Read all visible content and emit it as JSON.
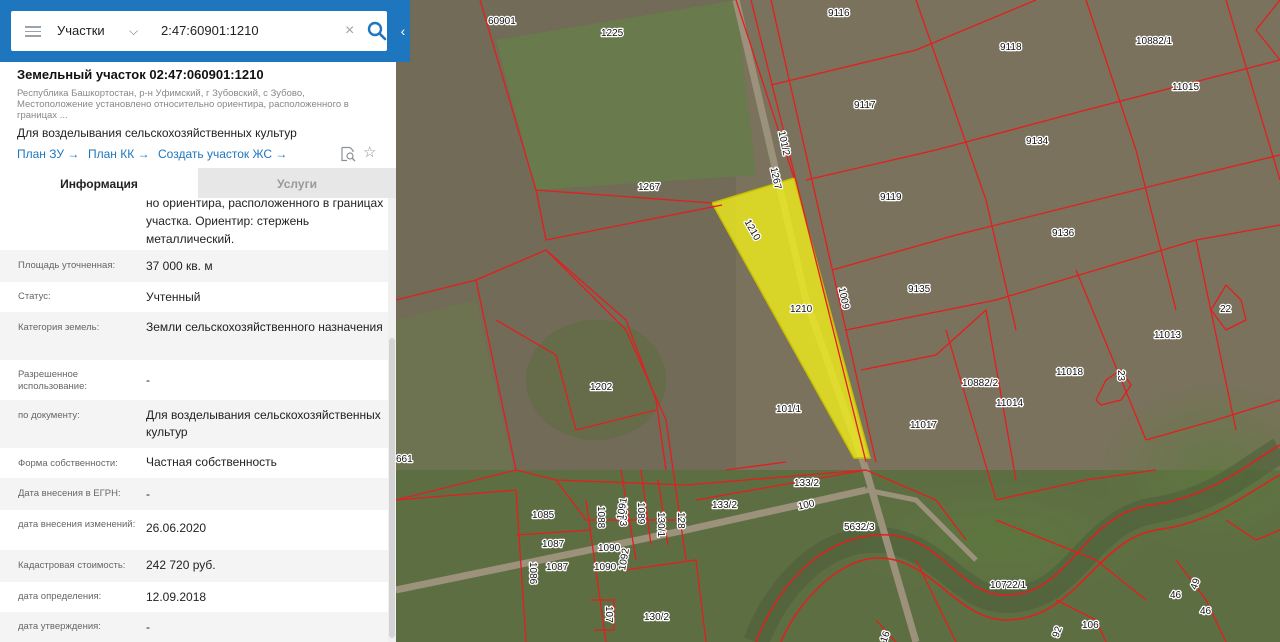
{
  "search": {
    "category": "Участки",
    "query": "2:47:60901:1210"
  },
  "object": {
    "title": "Земельный участок 02:47:060901:1210",
    "address": "Республика Башкортостан, р-н Уфимский, г Зубовский, с Зубово, Местоположение установлено относительно ориентира, расположенного в границах ...",
    "purpose": "Для возделывания сельскохозяйственных культур"
  },
  "links": {
    "plan_zu": "План ЗУ →",
    "plan_kk": "План КК →",
    "create_zhs": "Создать участок ЖС →"
  },
  "icons": {
    "menu": "hamburger-icon",
    "dropdown": "chevron-down-icon",
    "clear": "close-icon",
    "search": "search-icon",
    "collapse": "chevron-left-icon",
    "doc_search": "document-search-icon",
    "favorite": "star-icon"
  },
  "tabs": {
    "info": "Информация",
    "services": "Услуги"
  },
  "info_partial": "но ориентира, расположенного в границах участка. Ориентир: стержень металлический.",
  "info_rows": [
    {
      "label": "Площадь уточненная:",
      "value": "37 000 кв. м"
    },
    {
      "label": "Статус:",
      "value": "Учтенный"
    },
    {
      "label": "Категория земель:",
      "value": "Земли сельскохозяйственного назначения"
    },
    {
      "label": "Разрешенное использование:",
      "value": "-"
    },
    {
      "label": "по документу:",
      "value": "Для возделывания сельскохозяйственных культур"
    },
    {
      "label": "Форма собственности:",
      "value": "Частная собственность"
    },
    {
      "label": "Дата внесения в ЕГРН:",
      "value": "-"
    },
    {
      "label": "дата внесения изменений:",
      "value": "26.06.2020"
    },
    {
      "label": "Кадастровая стоимость:",
      "value": "242 720 руб."
    },
    {
      "label": "дата определения:",
      "value": "12.09.2018"
    },
    {
      "label": "дата утверждения:",
      "value": "-"
    }
  ],
  "map": {
    "parcel_labels": [
      "60901",
      "1225",
      "9116",
      "9118",
      "10882/1",
      "11015",
      "9117",
      "9134",
      "101/2",
      "1267",
      "1267",
      "1210",
      "1210",
      "9119",
      "9136",
      "1009",
      "9135",
      "22",
      "11013",
      "1202",
      "10882/2",
      "11018",
      "23",
      "11014",
      "101/1",
      "11017",
      "661",
      "133/2",
      "133/2",
      "100",
      "5632/3",
      "1085",
      "1088",
      "1093",
      "1089",
      "1091",
      "130/1",
      "128",
      "1087",
      "1090",
      "1092",
      "1086",
      "1087",
      "1090",
      "10722/1",
      "107",
      "130/2",
      "49",
      "46",
      "46",
      "106",
      "92",
      "16"
    ],
    "selected_parcel_fill": "#f2ef1a",
    "boundary_color": "#e41e1e"
  }
}
